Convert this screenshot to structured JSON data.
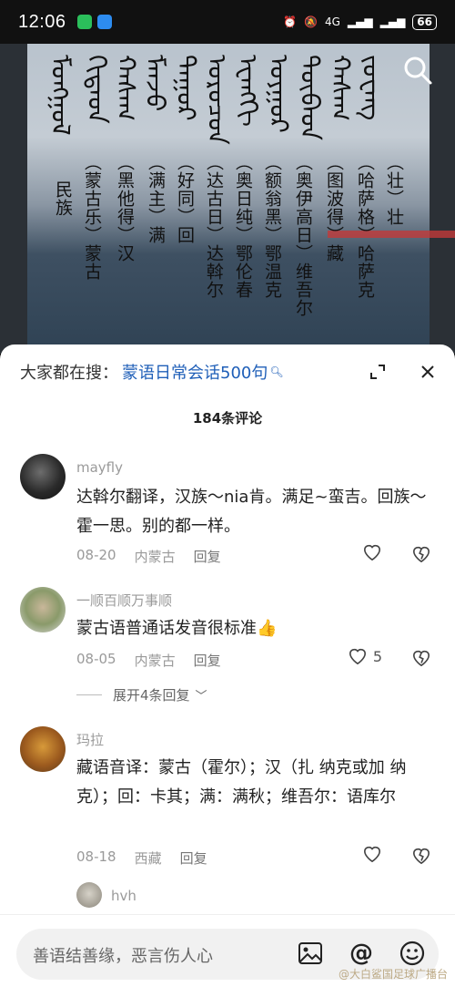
{
  "status_bar": {
    "time": "12:06",
    "network": "4G",
    "battery": "66"
  },
  "video": {
    "mongol_script_cols": [
      "ᠮᠣᠩᠭᠣᠯ",
      "ᠬᠢᠲᠠᠳ",
      "ᠬᠠᠰᠠᠭ",
      "ᠮᠠᠨᠵᠤ",
      "ᠳᠠᠭᠤᠷ",
      "ᠣᠷᠣᠴᠣᠨ",
      "ᠡᠸᠡᠩᠬᠢ",
      "ᠤᠶᠭᠤᠷ",
      "ᠲᠥᠪᠡᠳ",
      "ᠬᠠᠰᠠᠭ",
      "ᠵᠤᠸᠠᠩ"
    ],
    "ethnic_label": "民族",
    "col_mongol": "（蒙古乐）蒙古",
    "col_han": "（黑他得）汉",
    "col_manchu": "（满主）满",
    "col_hui": "（好同）回",
    "col_daur": "（达古日）达斡尔",
    "col_oroqen": "（奥日纯）鄂伦春",
    "col_ewenki": "（额翁黑）鄂温克",
    "col_uyghur": "（奥伊高日）维吾尔",
    "col_tibet": "（图波得）藏",
    "col_kazakh": "（哈萨格）哈萨克",
    "col_zhuang": "（壮）壮"
  },
  "sheet": {
    "search_label": "大家都在搜：",
    "search_keyword": "蒙语日常会话500句",
    "comment_count": "184条评论"
  },
  "comments": [
    {
      "user": "mayfly",
      "text": "达斡尔翻译，汉族～nia肯。满足~蛮吉。回族～霍一思。别的都一样。",
      "date": "08-20",
      "location": "内蒙古",
      "reply": "回复",
      "likes": ""
    },
    {
      "user": "一顺百顺万事顺",
      "text": "蒙古语普通话发音很标准👍",
      "date": "08-05",
      "location": "内蒙古",
      "reply": "回复",
      "likes": "5",
      "expand": "展开4条回复"
    },
    {
      "user": "玛拉",
      "text": "藏语音译：蒙古（霍尔）；汉（扎 纳克或加 纳克）；回：卡其；满：满秋；维吾尔：语库尔",
      "date": "08-18",
      "location": "西藏",
      "reply": "回复",
      "likes": ""
    },
    {
      "user": "hvh"
    }
  ],
  "input": {
    "placeholder": "善语结善缘，恶言伤人心",
    "watermark": "@大白鲨国足球广播台"
  },
  "colors": {
    "accent_link": "#1f5fb8",
    "gray_text": "#9a9a9a"
  }
}
